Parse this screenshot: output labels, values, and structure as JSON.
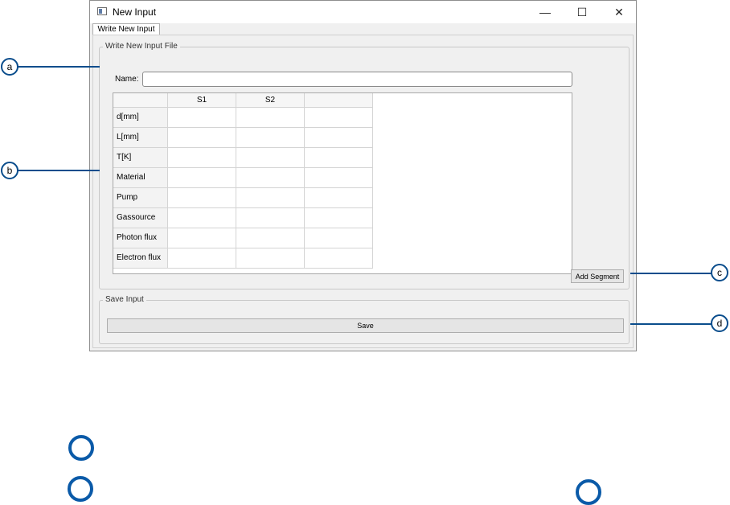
{
  "window": {
    "title": "New Input",
    "minimize_glyph": "—",
    "maximize_glyph": "☐",
    "close_glyph": "✕"
  },
  "tabs": [
    {
      "label": "Write New Input"
    }
  ],
  "write_group": {
    "title": "Write New Input File",
    "name_label": "Name:",
    "name_value": "",
    "name_placeholder": ""
  },
  "table": {
    "columns": [
      "S1",
      "S2",
      ""
    ],
    "rows": [
      "d[mm]",
      "L[mm]",
      "T[K]",
      "Material",
      "Pump",
      "Gassource",
      "Photon flux",
      "Electron flux"
    ]
  },
  "add_segment_label": "Add Segment",
  "save_group": {
    "title": "Save Input",
    "save_label": "Save"
  },
  "callouts": [
    "a",
    "b",
    "c",
    "d"
  ],
  "colors": {
    "callout": "#0a4d8c",
    "legend_ring": "#0a5aa8"
  }
}
